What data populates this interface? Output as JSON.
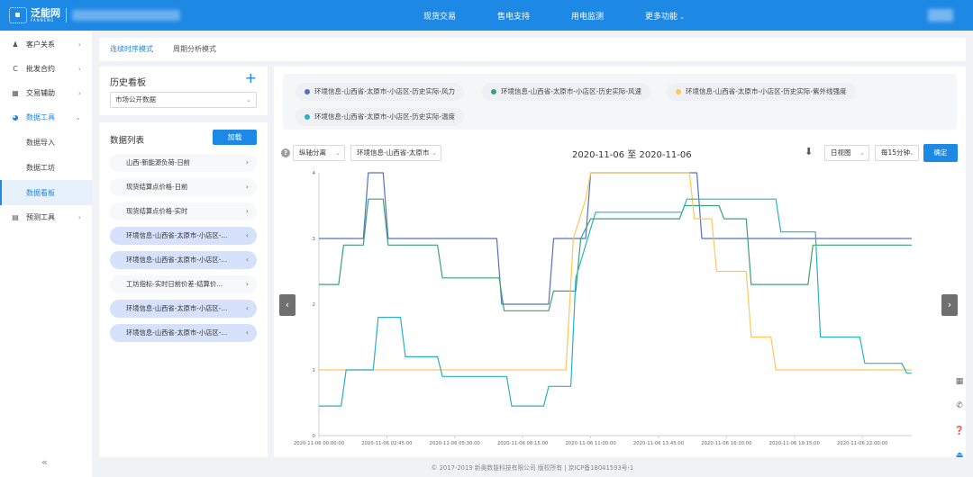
{
  "header": {
    "logo_cn": "泛能网",
    "logo_en": "FANNENG",
    "nav": [
      "现货交易",
      "售电支持",
      "用电监测",
      "更多功能"
    ]
  },
  "sidebar": {
    "items": [
      {
        "label": "客户关系",
        "icon": "users-icon"
      },
      {
        "label": "批发合约",
        "icon": "contract-icon"
      },
      {
        "label": "交易辅助",
        "icon": "trade-icon"
      },
      {
        "label": "数据工具",
        "icon": "pie-chart-icon"
      },
      {
        "label": "预测工具",
        "icon": "forecast-icon"
      }
    ],
    "sub_items": [
      "数据导入",
      "数据工坊",
      "数据看板"
    ],
    "collapse_label": "«"
  },
  "mode_tabs": [
    "连续时序模式",
    "周期分析模式"
  ],
  "history": {
    "title": "历史看板",
    "add_label": "+",
    "selected": "市场公开数据"
  },
  "data_list": {
    "title": "数据列表",
    "load_label": "加载",
    "items": [
      {
        "label": "山西-新能源负荷-日前",
        "selected": false
      },
      {
        "label": "现货结算点价格-日前",
        "selected": false
      },
      {
        "label": "现货结算点价格-实时",
        "selected": false
      },
      {
        "label": "环境信息-山西省-太原市-小店区-...",
        "selected": true
      },
      {
        "label": "环境信息-山西省-太原市-小店区-...",
        "selected": true
      },
      {
        "label": "工坊指标-实时日前价差-结算价...",
        "selected": false
      },
      {
        "label": "环境信息-山西省-太原市-小店区-...",
        "selected": true
      },
      {
        "label": "环境信息-山西省-太原市-小店区-...",
        "selected": true
      }
    ]
  },
  "chart_panel": {
    "legend": [
      {
        "name": "环境信息-山西省-太原市-小店区-历史实际-风力",
        "color": "#5470c6"
      },
      {
        "name": "环境信息-山西省-太原市-小店区-历史实际-风速",
        "color": "#3ba272"
      },
      {
        "name": "环境信息-山西省-太原市-小店区-历史实际-紫外线强度",
        "color": "#fac858"
      },
      {
        "name": "环境信息-山西省-太原市-小店区-历史实际-温度",
        "color": "#2ab0c5"
      }
    ],
    "axis_mode": "纵轴分离",
    "location_filter": "环境信息-山西省-太原市",
    "date_range": "2020-11-06 至 2020-11-06",
    "view": "日视图",
    "interval": "每15分钟",
    "ok_label": "确定",
    "help_label": "?",
    "prev_label": "‹",
    "next_label": "›"
  },
  "chart_data": {
    "type": "line",
    "x_labels": [
      "2020-11-06 00:00:00",
      "2020-11-06 02:45:00",
      "2020-11-06 05:30:00",
      "2020-11-06 08:15:00",
      "2020-11-06 11:00:00",
      "2020-11-06 13:45:00",
      "2020-11-06 16:30:00",
      "2020-11-06 19:15:00",
      "2020-11-06 22:00:00"
    ],
    "x_range_hours": [
      0,
      24
    ],
    "y_ticks": [
      0,
      1,
      2,
      3,
      4
    ],
    "ylim": [
      0,
      4
    ],
    "grid": false,
    "series": [
      {
        "name": "环境信息-山西省-太原市-小店区-历史实际-风力",
        "color": "#5470c6",
        "points": [
          [
            0,
            3
          ],
          [
            1.8,
            3
          ],
          [
            2,
            4
          ],
          [
            2.6,
            4
          ],
          [
            2.8,
            3
          ],
          [
            7.2,
            3
          ],
          [
            7.4,
            2
          ],
          [
            9.3,
            2
          ],
          [
            9.5,
            3
          ],
          [
            10.8,
            3
          ],
          [
            11,
            4
          ],
          [
            15.3,
            4
          ],
          [
            15.5,
            3
          ],
          [
            24,
            3
          ]
        ]
      },
      {
        "name": "环境信息-山西省-太原市-小店区-历史实际-风速",
        "color": "#3ba272",
        "points": [
          [
            0,
            2.3
          ],
          [
            0.8,
            2.3
          ],
          [
            1,
            2.9
          ],
          [
            1.8,
            2.9
          ],
          [
            2,
            3.6
          ],
          [
            2.6,
            3.6
          ],
          [
            2.8,
            2.9
          ],
          [
            4.8,
            2.9
          ],
          [
            5,
            2.4
          ],
          [
            7.3,
            2.4
          ],
          [
            7.5,
            1.9
          ],
          [
            9.3,
            1.9
          ],
          [
            9.5,
            2.2
          ],
          [
            10.4,
            2.2
          ],
          [
            10.6,
            3
          ],
          [
            11,
            3.3
          ],
          [
            14.6,
            3.3
          ],
          [
            14.8,
            3.5
          ],
          [
            16.2,
            3.5
          ],
          [
            16.4,
            3.3
          ],
          [
            17.3,
            3.3
          ],
          [
            17.5,
            2.3
          ],
          [
            19.8,
            2.3
          ],
          [
            20,
            2.9
          ],
          [
            24,
            2.9
          ]
        ]
      },
      {
        "name": "环境信息-山西省-太原市-小店区-历史实际-紫外线强度",
        "color": "#fac858",
        "points": [
          [
            0,
            1
          ],
          [
            6.5,
            1
          ],
          [
            6.7,
            1
          ],
          [
            10,
            1
          ],
          [
            10.3,
            3
          ],
          [
            10.8,
            3.6
          ],
          [
            11,
            4
          ],
          [
            15,
            4
          ],
          [
            15.2,
            3.3
          ],
          [
            15.9,
            3.3
          ],
          [
            16.1,
            2.5
          ],
          [
            17.3,
            2.5
          ],
          [
            17.5,
            1.5
          ],
          [
            18.3,
            1.5
          ],
          [
            18.5,
            1
          ],
          [
            24,
            1
          ]
        ]
      },
      {
        "name": "环境信息-山西省-太原市-小店区-历史实际-温度",
        "color": "#2ab0c5",
        "points": [
          [
            0,
            0.45
          ],
          [
            0.9,
            0.45
          ],
          [
            1.1,
            1
          ],
          [
            2.2,
            1
          ],
          [
            2.4,
            1.8
          ],
          [
            3.3,
            1.8
          ],
          [
            3.5,
            1.2
          ],
          [
            4.8,
            1.2
          ],
          [
            5,
            0.9
          ],
          [
            7.6,
            0.9
          ],
          [
            7.8,
            0.45
          ],
          [
            9.1,
            0.45
          ],
          [
            9.3,
            0.75
          ],
          [
            10.2,
            0.75
          ],
          [
            10.4,
            2.4
          ],
          [
            11.2,
            3.4
          ],
          [
            14.7,
            3.4
          ],
          [
            14.9,
            3.6
          ],
          [
            18.5,
            3.6
          ],
          [
            18.7,
            3.1
          ],
          [
            20.1,
            3.1
          ],
          [
            20.3,
            1.5
          ],
          [
            21.9,
            1.5
          ],
          [
            22.1,
            1.1
          ],
          [
            23.6,
            1.1
          ],
          [
            23.8,
            0.95
          ],
          [
            24,
            0.95
          ]
        ]
      }
    ]
  },
  "footer": "© 2017-2019 新奥数能科技有限公司 版权所有 | 京ICP备18041593号-1",
  "icons": [
    "download-icon",
    "grid-icon",
    "phone-icon",
    "help-circle-icon",
    "eject-icon"
  ]
}
